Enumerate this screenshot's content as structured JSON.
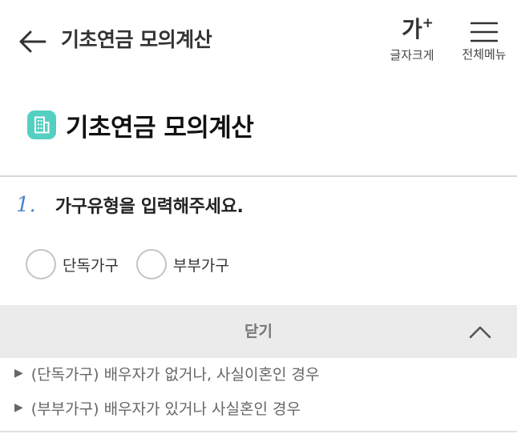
{
  "header": {
    "title": "기초연금 모의계산",
    "font_size": {
      "glyph": "가",
      "superscript": "+",
      "label": "글자크게"
    },
    "menu": {
      "label": "전체메뉴"
    }
  },
  "page": {
    "heading": "기초연금 모의계산",
    "icon": "building-icon",
    "accent_color": "#55cfc2"
  },
  "question": {
    "number": "1.",
    "text": "가구유형을 입력해주세요.",
    "number_color": "#4b84c6",
    "options": [
      {
        "label": "단독가구",
        "selected": false
      },
      {
        "label": "부부가구",
        "selected": false
      }
    ]
  },
  "toggle": {
    "label": "닫기",
    "icon": "chevron-up-icon"
  },
  "notes": [
    {
      "arrow": "▶",
      "text": "(단독가구) 배우자가 없거나, 사실이혼인 경우"
    },
    {
      "arrow": "▶",
      "text": "(부부가구) 배우자가 있거나 사실혼인 경우"
    }
  ]
}
